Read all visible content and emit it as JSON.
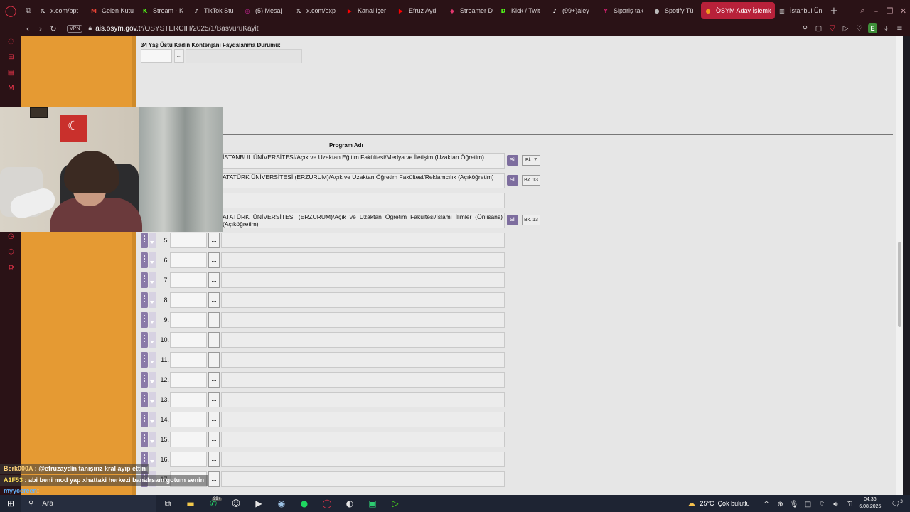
{
  "browser": {
    "tabs": [
      {
        "label": "x.com/bpt",
        "icon": "x-icon",
        "color": "#ffffff",
        "glyph": "𝕏"
      },
      {
        "label": "Gelen Kutu",
        "icon": "gmail-icon",
        "color": "#ea4335",
        "glyph": "M"
      },
      {
        "label": "Stream - K",
        "icon": "kick-icon",
        "color": "#53fc18",
        "glyph": "K"
      },
      {
        "label": "TikTok Stu",
        "icon": "tiktok-icon",
        "color": "#ffffff",
        "glyph": "♪"
      },
      {
        "label": "(5) Mesaj",
        "icon": "instagram-icon",
        "color": "#d6249f",
        "glyph": "◎"
      },
      {
        "label": "x.com/exp",
        "icon": "x-icon",
        "color": "#ffffff",
        "glyph": "𝕏"
      },
      {
        "label": "Kanal içer",
        "icon": "youtube-icon",
        "color": "#ff0000",
        "glyph": "▶"
      },
      {
        "label": "Efruz Ayd",
        "icon": "youtube-icon",
        "color": "#ff0000",
        "glyph": "▶"
      },
      {
        "label": "Streamer D",
        "icon": "streamer-icon",
        "color": "#e0376d",
        "glyph": "◆"
      },
      {
        "label": "Kick / Twit",
        "icon": "kick-icon",
        "color": "#53fc18",
        "glyph": "D"
      },
      {
        "label": "(99+)aley",
        "icon": "tiktok-icon",
        "color": "#ffffff",
        "glyph": "♪"
      },
      {
        "label": "Sipariş tak",
        "icon": "yemeksepeti-icon",
        "color": "#d11f6e",
        "glyph": "Y"
      },
      {
        "label": "Spotify Tü",
        "icon": "spotify-icon",
        "color": "#bbbbbb",
        "glyph": "●"
      },
      {
        "label": "ÖSYM Aday İşlemle",
        "icon": "osym-icon",
        "color": "#f29a1f",
        "glyph": "●",
        "active": true
      },
      {
        "label": "İstanbul Ün",
        "icon": "page-icon",
        "color": "#cccccc",
        "glyph": "▥"
      }
    ],
    "url_host": "ais.osym.gov.tr",
    "url_path": "/OSYSTERCIH/2025/1/BasvuruKayit",
    "vpn_label": "VPN",
    "extension_letter": "E"
  },
  "form": {
    "quota_label": "34 Yaş Üstü Kadın Kontenjanı Faydalanma Durumu:",
    "quota_button": "...",
    "program_column": "Program Adı",
    "filled_programs": [
      {
        "name": "İSTANBUL ÜNİVERSİTESİ/Açık ve Uzaktan Eğitim Fakültesi/Medya ve İletişim (Uzaktan Öğretim)",
        "delete": "Sil",
        "bk": "Bk. 7"
      },
      {
        "name": "ATATÜRK ÜNİVERSİTESİ (ERZURUM)/Açık ve Uzaktan Öğretim Fakültesi/Reklamcılık (Açıköğretim)",
        "delete": "Sil",
        "bk": "Bk. 13"
      },
      {
        "name": ""
      },
      {
        "name": "ATATÜRK ÜNİVERSİTESİ (ERZURUM)/Açık ve Uzaktan Öğretim Fakültesi/İslami İlimler (Önlisans) (Açıköğretim)",
        "delete": "Sil",
        "bk": "Bk. 13"
      }
    ],
    "empty_rows": [
      "5.",
      "6.",
      "7.",
      "8.",
      "9.",
      "10.",
      "11.",
      "12.",
      "13.",
      "14.",
      "15.",
      "16.",
      "17."
    ],
    "dots_label": "..."
  },
  "chat": [
    {
      "user": "Berk000A",
      "text": ": @efruzaydin tanışırız kral ayıp ettin"
    },
    {
      "user": "A1F53",
      "text": ": abi beni mod yap xhattaki herkezi banalrsam gotum senin"
    },
    {
      "user": "myycereen",
      "text": ":"
    }
  ],
  "taskbar": {
    "search_placeholder": "Ara",
    "badge": "99+",
    "temperature": "25°C",
    "weather": "Çok bulutlu",
    "time": "04:36",
    "date": "6.08.2025",
    "notification_count": "3"
  }
}
